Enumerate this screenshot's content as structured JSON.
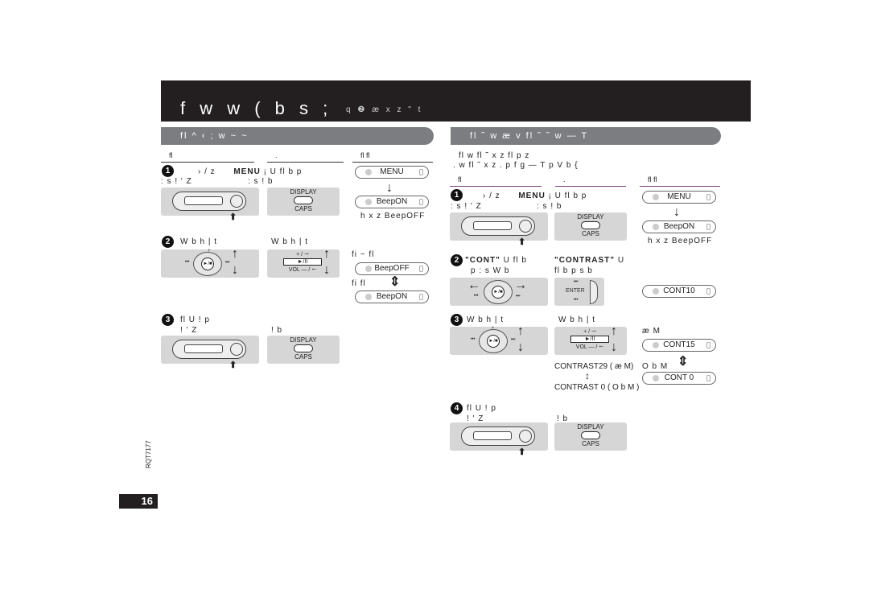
{
  "header": {
    "title": "f w  w ( b s ;",
    "subtitle": "q ❷ æ x z   \" t"
  },
  "left_section": {
    "title": "fl   ^ ‹  ; w  ~ ~",
    "col_heads": [
      "fl",
      ".",
      "fl  fl"
    ],
    "step1": {
      "num": "1",
      "line1_a": "› / z",
      "line1_key": "MENU",
      "line1_b": "¡ U fl  b   p",
      "line2_a": ": s ! '  Z",
      "line2_b": ": s ! b"
    },
    "step2": {
      "num": "2",
      "label_a": "W b h | t",
      "label_b": "W b h | t",
      "note_top": "fi ~ fl",
      "note_bottom": "fi  fl"
    },
    "step3": {
      "num": "3",
      "line1": "fl  U !     p",
      "line2_a": "! '  Z",
      "line2_b": "! b"
    },
    "lcd": {
      "menu": "MENU",
      "beep_on": "BeepON",
      "beep_off": "BeepOFF",
      "note": "h x z   BeepOFF"
    }
  },
  "right_section": {
    "title": "fl  ˜    w æ v   fl  ˜    ˜   w — T",
    "intro_1": "fl  w fl  ˜    x z    fl  p z",
    "intro_2": ". w fl  ˜    x z  . p f  g  — T p V  b {",
    "col_heads": [
      "fl",
      ".",
      "fl  fl"
    ],
    "step1": {
      "num": "1",
      "line1_a": "› / z",
      "line1_key": "MENU",
      "line1_b": "¡ U fl  b   p",
      "line2_a": ": s ! '  Z",
      "line2_b": ": s ! b"
    },
    "step2": {
      "num": "2",
      "key_a": "\"CONT\"",
      "text_a": "U fl   b",
      "line2_a": "p : s W b",
      "key_b": "\"CONTRAST\"",
      "text_b": "U",
      "line2_b": "fl   b    p s b"
    },
    "step3": {
      "num": "3",
      "label_a": "W b h | t",
      "label_b": "W b h | t",
      "contrast_high": "CONTRAST29 ( æ M)",
      "contrast_low": "CONTRAST 0 ( O b M )",
      "note_high": "æ M",
      "note_low": "O b M"
    },
    "step4": {
      "num": "4",
      "line1": "fl  U !     p",
      "line2_a": "! '  Z",
      "line2_b": "! b"
    },
    "lcd": {
      "menu": "MENU",
      "beep_on": "BeepON",
      "note": "h x z   BeepOFF",
      "cont10": "CONT10",
      "cont15": "CONT15",
      "cont0": "CONT 0"
    }
  },
  "buttons": {
    "display": "DISPLAY",
    "caps": "CAPS",
    "enter": "ENTER",
    "vol_up": "+ / ⇀",
    "play": "►/II",
    "vol_down": "VOL  — / ↼",
    "play_jog": "►/■"
  },
  "footer": {
    "page_number": "16",
    "doc_id": "RQT7177"
  }
}
